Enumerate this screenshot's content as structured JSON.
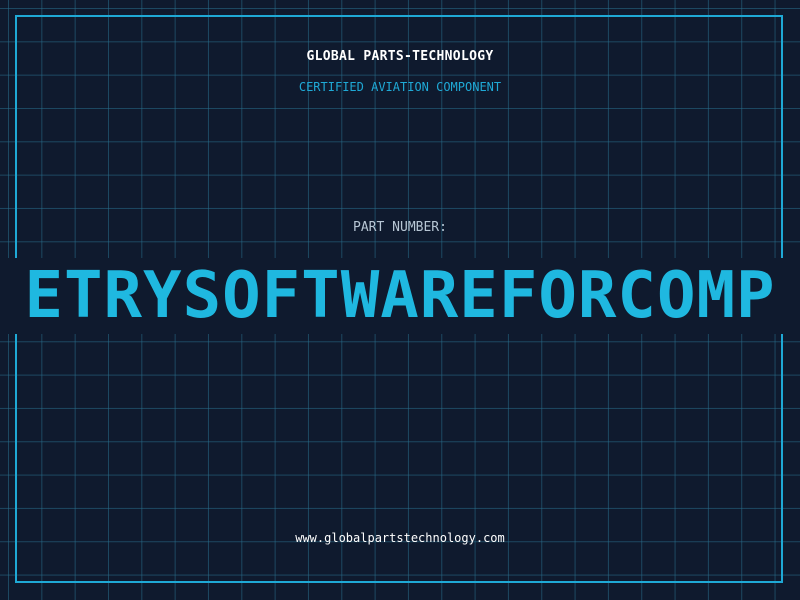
{
  "header": {
    "company": "GLOBAL PARTS-TECHNOLOGY",
    "subtitle": "CERTIFIED AVIATION COMPONENT"
  },
  "part": {
    "label": "PART NUMBER:",
    "value": "ETRYSOFTWAREFORCOMP"
  },
  "footer": {
    "url": "www.globalpartstechnology.com"
  },
  "colors": {
    "background": "#0f1a2e",
    "accent": "#1fa9d6",
    "grid": "#286e8c"
  }
}
